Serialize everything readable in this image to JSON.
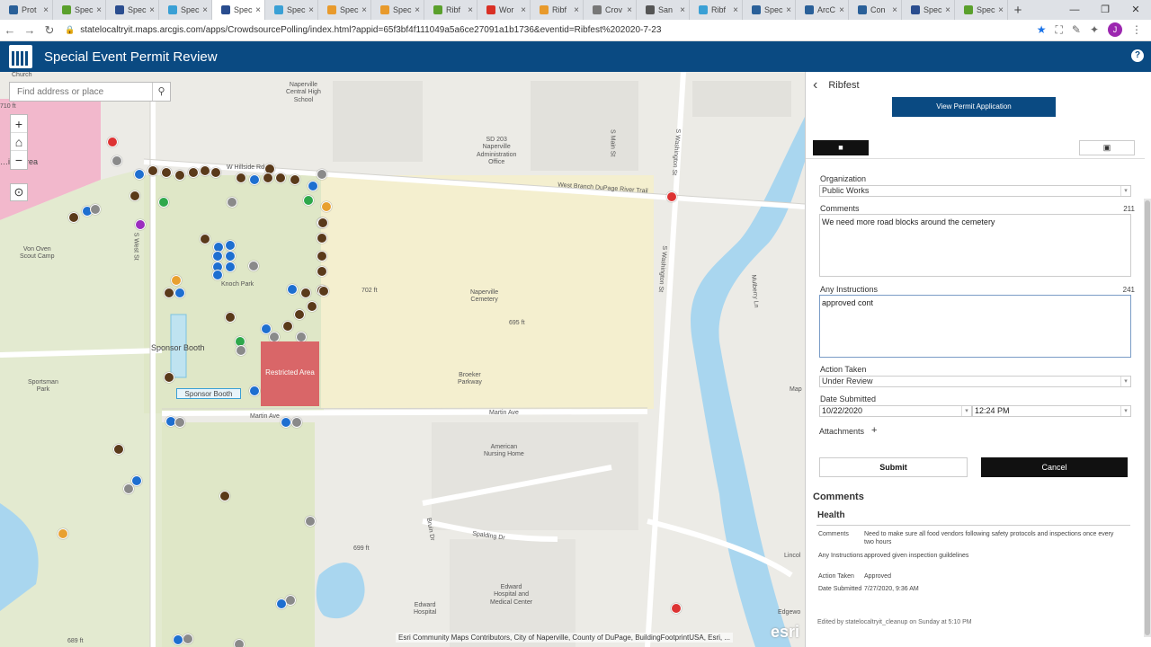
{
  "browser": {
    "tabs": [
      {
        "label": "Prot",
        "color": "#2a6099"
      },
      {
        "label": "Spec",
        "color": "#5aa02c"
      },
      {
        "label": "Spec",
        "color": "#2a4d8f"
      },
      {
        "label": "Spec",
        "color": "#3aa0d5"
      },
      {
        "label": "Spec",
        "color": "#2a4d8f",
        "active": true
      },
      {
        "label": "Spec",
        "color": "#3aa0d5"
      },
      {
        "label": "Spec",
        "color": "#e89a2c"
      },
      {
        "label": "Spec",
        "color": "#e89a2c"
      },
      {
        "label": "Ribf",
        "color": "#5aa02c"
      },
      {
        "label": "Wor",
        "color": "#d93025"
      },
      {
        "label": "Ribf",
        "color": "#e89a2c"
      },
      {
        "label": "Crov",
        "color": "#777777"
      },
      {
        "label": "San",
        "color": "#555555"
      },
      {
        "label": "Ribf",
        "color": "#3aa0d5"
      },
      {
        "label": "Spec",
        "color": "#2a6099"
      },
      {
        "label": "ArcC",
        "color": "#2a6099"
      },
      {
        "label": "Con",
        "color": "#2a6099"
      },
      {
        "label": "Spec",
        "color": "#2a4d8f"
      },
      {
        "label": "Spec",
        "color": "#5aa02c"
      }
    ],
    "new_tab": "+",
    "url": "statelocaltryit.maps.arcgis.com/apps/CrowdsourcePolling/index.html?appid=65f3bf4f111049a5a6ce27091a1b1736&eventid=Ribfest%202020-7-23",
    "avatar_letter": "J"
  },
  "app": {
    "title": "Special Event Permit Review"
  },
  "map": {
    "search_placeholder": "Find address or place",
    "zoom_in": "+",
    "home": "⌂",
    "zoom_out": "−",
    "labels": {
      "church": "Church",
      "elev_top": "710 ft",
      "parking_area": "…ing Area",
      "naperville_central": "Naperville\nCentral High\nSchool",
      "sd203": "SD 203\nNaperville\nAdministration\nOffice",
      "von_oven": "Von Oven\nScout Camp",
      "hillside": "W Hillside Rd",
      "dupage_trail": "West Branch DuPage River Trail",
      "knoch_park": "Knoch Park",
      "naperville_cemetery": "Naperville\nCemetery",
      "elev_702": "702 ft",
      "elev_695": "695 ft",
      "broeker": "Broeker\nParkway",
      "sportsman": "Sportsman\nPark",
      "martin_ave": "Martin Ave",
      "martin_ave2": "Martin Ave",
      "american_nursing": "American\nNursing Home",
      "spalding": "Spalding Dr",
      "edward_hospital": "Edward\nHospital and\nMedical Center",
      "edward_hosp2": "Edward\nHospital",
      "s_west_st": "S West St",
      "s_washington": "S Washington St",
      "n_washington": "S Washington St",
      "bruin": "Bruin Dr",
      "elev_699": "699 ft",
      "elev_689": "689 ft",
      "s_main": "S Main St",
      "mulberry": "Mulberry Ln",
      "lincoln": "Lincol",
      "edgewood": "Edgewo",
      "map_right": "Map"
    },
    "sponsor_booth_1": "Sponsor Booth",
    "sponsor_booth_2": "Sponsor Booth",
    "restricted_area": "Restricted Area",
    "attribution": "Esri Community Maps Contributors, City of Naperville, County of DuPage, BuildingFootprintUSA, Esri, ...",
    "esri_logo": "esri"
  },
  "panel": {
    "event_title": "Ribfest",
    "view_permit_label": "View Permit Application",
    "organization_label": "Organization",
    "organization_value": "Public Works",
    "comments_label": "Comments",
    "comments_count": "211",
    "comments_value": "We need more road blocks around the cemetery",
    "instructions_label": "Any Instructions",
    "instructions_count": "241",
    "instructions_value": "approved cont",
    "action_label": "Action Taken",
    "action_value": "Under Review",
    "date_label": "Date Submitted",
    "date_value": "10/22/2020",
    "time_value": "12:24 PM",
    "attachments_label": "Attachments",
    "attachments_add": "+",
    "submit_label": "Submit",
    "cancel_label": "Cancel",
    "comments_section_title": "Comments",
    "comment_group": "Health",
    "entry": {
      "comments_key": "Comments",
      "comments_val": "Need to make sure all food vendors following safety protocols and inspections once every two hours",
      "instructions_key": "Any Instructions",
      "instructions_val": "approved given inspection guildelines",
      "action_key": "Action Taken",
      "action_val": "Approved",
      "date_key": "Date Submitted",
      "date_val": "7/27/2020, 9:36 AM"
    },
    "edited_by": "Edited by statelocaltryit_cleanup on Sunday at 5:10 PM"
  }
}
